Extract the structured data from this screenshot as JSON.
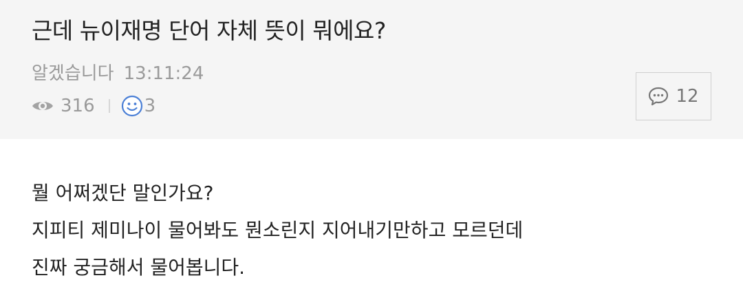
{
  "post": {
    "title": "근데 뉴이재명 단어 자체 뜻이 뭐에요?",
    "author": "알겠습니다",
    "time": "13:11:24",
    "views": "316",
    "likes": "3",
    "comments": "12"
  },
  "content": {
    "lines": [
      "뭘 어쩌겠단 말인가요?",
      "지피티 제미나이 물어봐도 뭔소린지 지어내기만하고 모르던데",
      "진짜 궁금해서 물어봅니다."
    ]
  },
  "icons": {
    "views": "eye-icon",
    "likes": "smile-icon",
    "comments": "comment-icon"
  },
  "colors": {
    "header_bg": "#f5f5f5",
    "smile_accent": "#4a7fd6"
  }
}
